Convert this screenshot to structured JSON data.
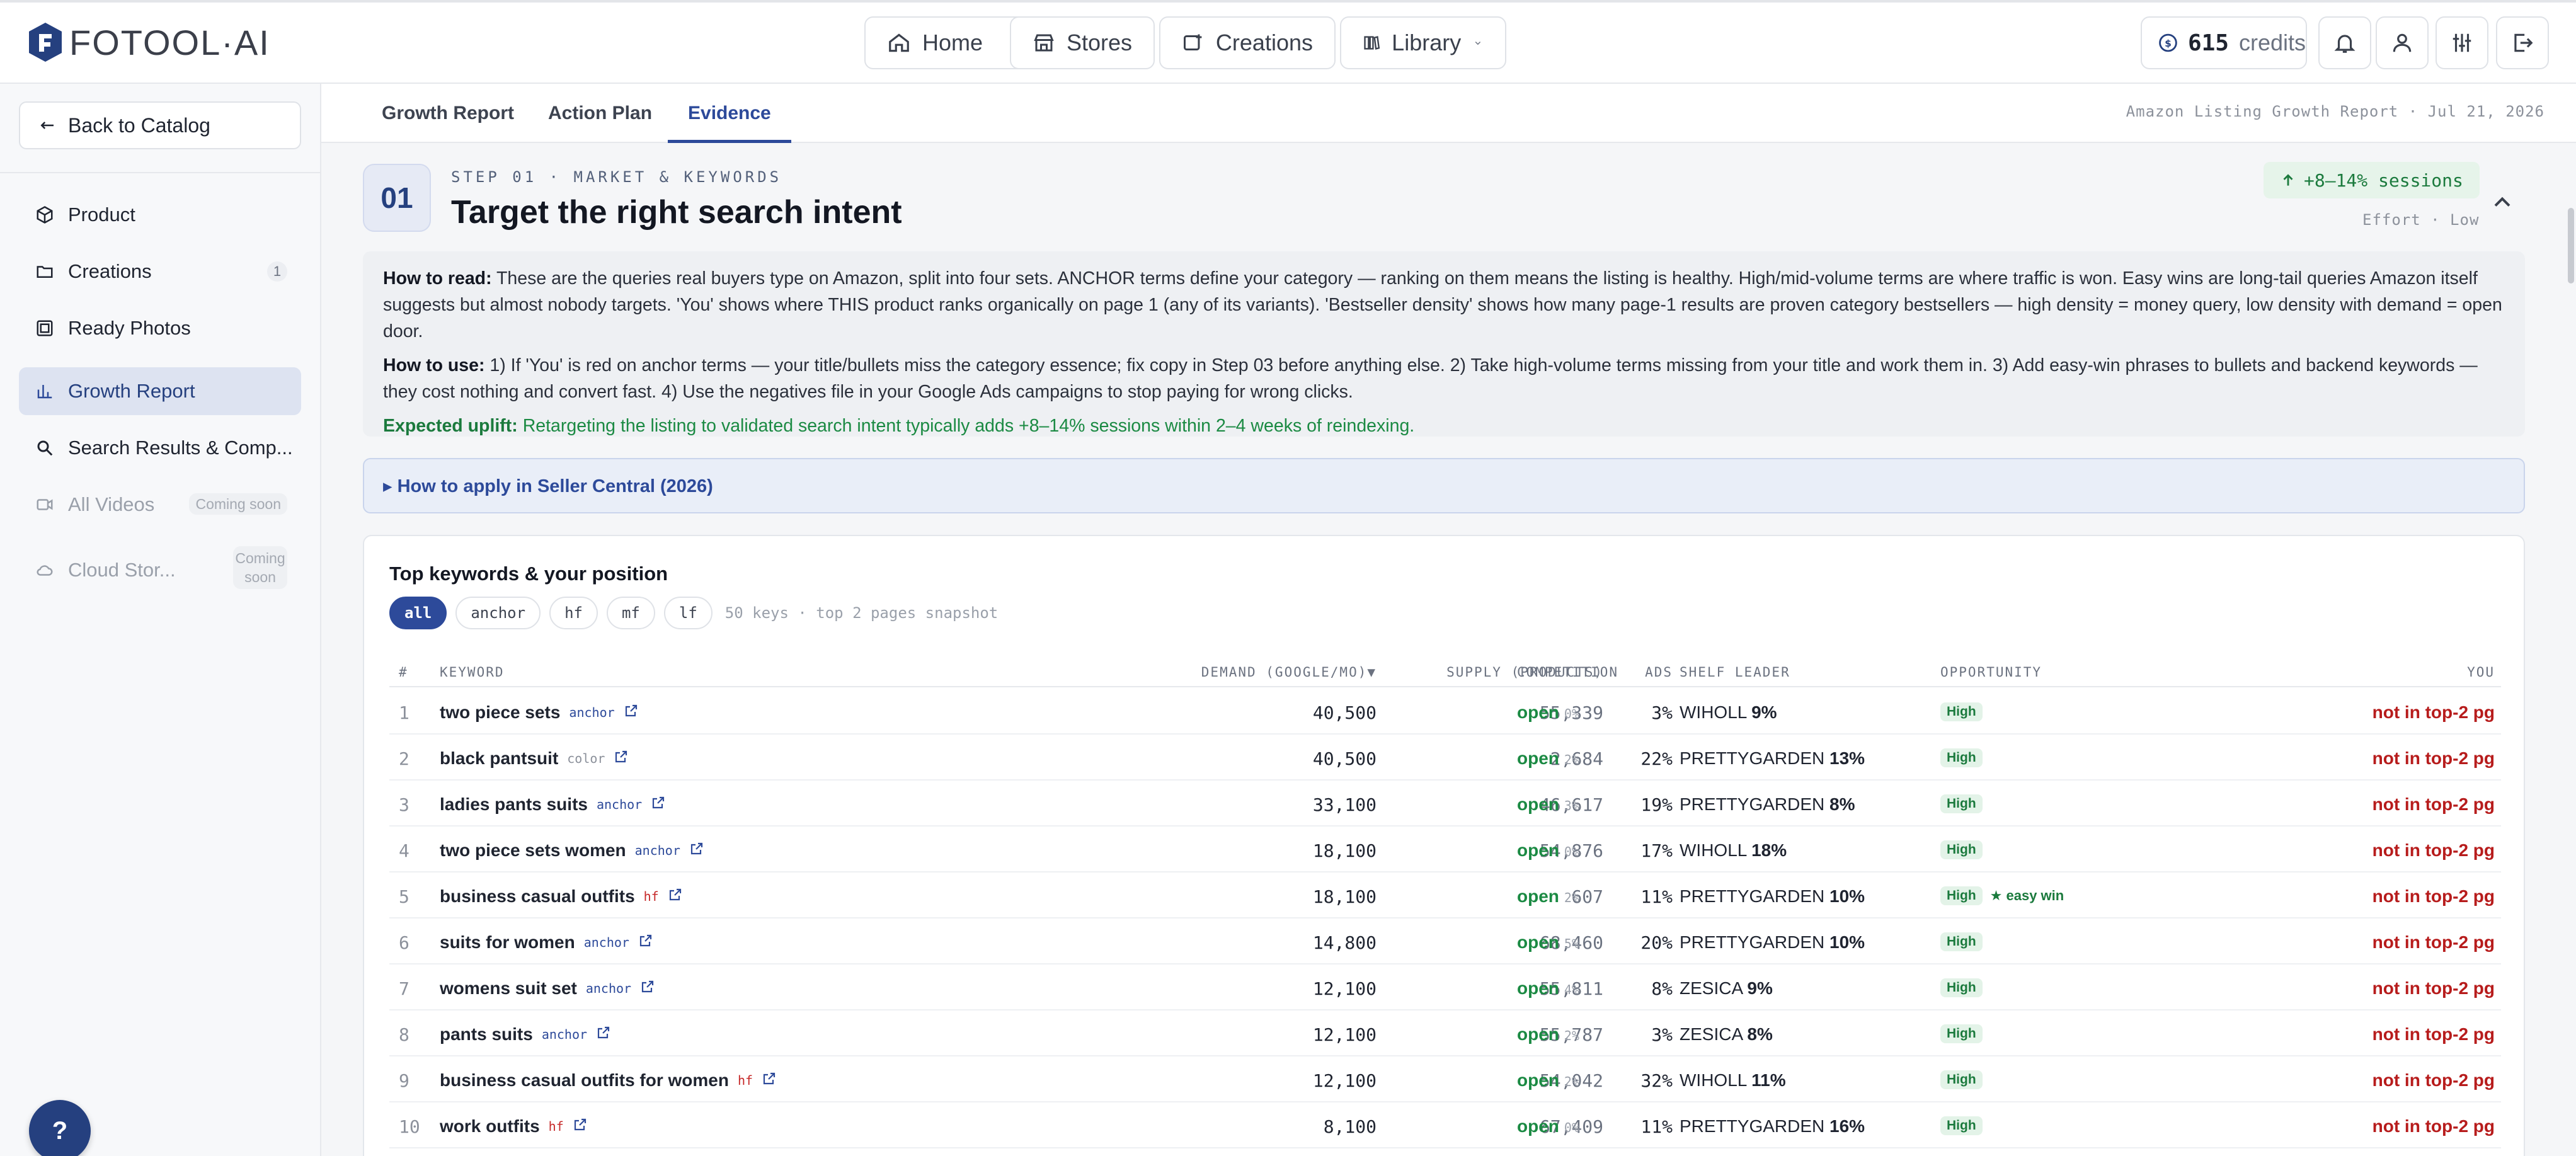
{
  "app": {
    "logo_text": "FOTOOL·AI"
  },
  "nav": {
    "home": "Home",
    "stores": "Stores",
    "creations": "Creations",
    "library": "Library"
  },
  "header": {
    "credits_value": "615",
    "credits_label": "credits"
  },
  "sidebar": {
    "back_label": "Back to Catalog",
    "items": [
      {
        "label": "Product"
      },
      {
        "label": "Creations",
        "count": "1"
      },
      {
        "label": "Ready Photos"
      },
      {
        "label": "Growth Report"
      },
      {
        "label": "Search Results & Comp..."
      },
      {
        "label": "All Videos",
        "badge": "Coming soon"
      },
      {
        "label": "Cloud Stor...",
        "badge_line1": "Coming",
        "badge_line2": "soon"
      }
    ],
    "help_label": "?"
  },
  "tabs": {
    "items": [
      "Growth Report",
      "Action Plan",
      "Evidence"
    ],
    "active": "Evidence",
    "meta": "Amazon Listing Growth Report · Jul 21, 2026"
  },
  "step": {
    "number": "01",
    "kicker": "STEP 01 · MARKET & KEYWORDS",
    "title": "Target the right search intent",
    "uplift": "+8–14% sessions",
    "effort": "Effort · Low"
  },
  "info": {
    "read_label": "How to read:",
    "read_text": "These are the queries real buyers type on Amazon, split into four sets. ANCHOR terms define your category — ranking on them means the listing is healthy. High/mid-volume terms are where traffic is won. Easy wins are long-tail queries Amazon itself suggests but almost nobody targets. 'You' shows where THIS product ranks organically on page 1 (any of its variants). 'Bestseller density' shows how many page-1 results are proven category bestsellers — high density = money query, low density with demand = open door.",
    "use_label": "How to use:",
    "use_text": "1) If 'You' is red on anchor terms — your title/bullets miss the category essence; fix copy in Step 03 before anything else. 2) Take high-volume terms missing from your title and work them in. 3) Add easy-win phrases to bullets and backend keywords — they cost nothing and convert fast. 4) Use the negatives file in your Google Ads campaigns to stop paying for wrong clicks.",
    "uplift_label": "Expected uplift:",
    "uplift_text": "Retargeting the listing to validated search intent typically adds +8–14% sessions within 2–4 weeks of reindexing.",
    "apply_label": "▸ How to apply in Seller Central (2026)"
  },
  "table": {
    "title": "Top keywords & your position",
    "filters": [
      "all",
      "anchor",
      "hf",
      "mf",
      "lf"
    ],
    "active_filter": "all",
    "filter_note": "50 keys · top 2 pages snapshot",
    "headers": {
      "idx": "#",
      "keyword": "KEYWORD",
      "demand": "DEMAND (GOOGLE/MO)▼",
      "supply": "SUPPLY (PRODUCTS)",
      "ads": "ADS",
      "competition": "COMPETITION",
      "leader": "SHELF LEADER",
      "opportunity": "OPPORTUNITY",
      "you": "YOU"
    },
    "rows": [
      {
        "idx": "1",
        "keyword": "two piece sets",
        "tag": "anchor",
        "demand": "40,500",
        "supply": "55,339",
        "ads": "3%",
        "comp": "open",
        "comp_pct": "0%",
        "leader": "WIHOLL",
        "leader_pct": "9%",
        "opp": "High",
        "extra": "",
        "you": "not in top-2 pg"
      },
      {
        "idx": "2",
        "keyword": "black pantsuit",
        "tag": "color",
        "demand": "40,500",
        "supply": "2,684",
        "ads": "22%",
        "comp": "open",
        "comp_pct": "2%",
        "leader": "PRETTYGARDEN",
        "leader_pct": "13%",
        "opp": "High",
        "extra": "",
        "you": "not in top-2 pg"
      },
      {
        "idx": "3",
        "keyword": "ladies pants suits",
        "tag": "anchor",
        "demand": "33,100",
        "supply": "46,617",
        "ads": "19%",
        "comp": "open",
        "comp_pct": "3%",
        "leader": "PRETTYGARDEN",
        "leader_pct": "8%",
        "opp": "High",
        "extra": "",
        "you": "not in top-2 pg"
      },
      {
        "idx": "4",
        "keyword": "two piece sets women",
        "tag": "anchor",
        "demand": "18,100",
        "supply": "54,876",
        "ads": "17%",
        "comp": "open",
        "comp_pct": "0%",
        "leader": "WIHOLL",
        "leader_pct": "18%",
        "opp": "High",
        "extra": "",
        "you": "not in top-2 pg"
      },
      {
        "idx": "5",
        "keyword": "business casual outfits",
        "tag": "hf",
        "demand": "18,100",
        "supply": "607",
        "ads": "11%",
        "comp": "open",
        "comp_pct": "2%",
        "leader": "PRETTYGARDEN",
        "leader_pct": "10%",
        "opp": "High",
        "extra": "★ easy win",
        "you": "not in top-2 pg"
      },
      {
        "idx": "6",
        "keyword": "suits for women",
        "tag": "anchor",
        "demand": "14,800",
        "supply": "68,460",
        "ads": "20%",
        "comp": "open",
        "comp_pct": "5%",
        "leader": "PRETTYGARDEN",
        "leader_pct": "10%",
        "opp": "High",
        "extra": "",
        "you": "not in top-2 pg"
      },
      {
        "idx": "7",
        "keyword": "womens suit set",
        "tag": "anchor",
        "demand": "12,100",
        "supply": "55,811",
        "ads": "8%",
        "comp": "open",
        "comp_pct": "4%",
        "leader": "ZESICA",
        "leader_pct": "9%",
        "opp": "High",
        "extra": "",
        "you": "not in top-2 pg"
      },
      {
        "idx": "8",
        "keyword": "pants suits",
        "tag": "anchor",
        "demand": "12,100",
        "supply": "55,787",
        "ads": "3%",
        "comp": "open",
        "comp_pct": "2%",
        "leader": "ZESICA",
        "leader_pct": "8%",
        "opp": "High",
        "extra": "",
        "you": "not in top-2 pg"
      },
      {
        "idx": "9",
        "keyword": "business casual outfits for women",
        "tag": "hf",
        "demand": "12,100",
        "supply": "54,042",
        "ads": "32%",
        "comp": "open",
        "comp_pct": "2%",
        "leader": "WIHOLL",
        "leader_pct": "11%",
        "opp": "High",
        "extra": "",
        "you": "not in top-2 pg"
      },
      {
        "idx": "10",
        "keyword": "work outfits",
        "tag": "hf",
        "demand": "8,100",
        "supply": "67,409",
        "ads": "11%",
        "comp": "open",
        "comp_pct": "0%",
        "leader": "PRETTYGARDEN",
        "leader_pct": "16%",
        "opp": "High",
        "extra": "",
        "you": "not in top-2 pg"
      }
    ]
  },
  "colors": {
    "accent": "#2d4a9a",
    "positive": "#1b8a43",
    "negative": "#b71c1c"
  }
}
